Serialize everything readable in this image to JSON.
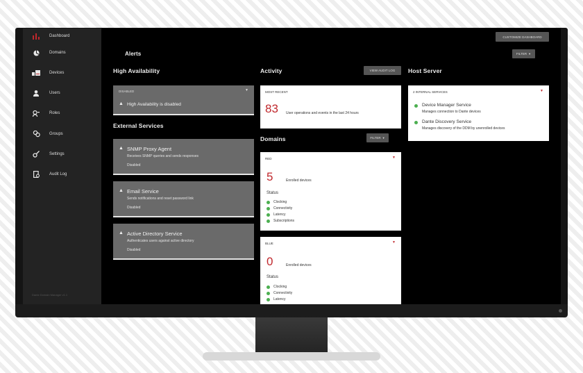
{
  "sidebar": {
    "items": [
      {
        "label": "Dashboard",
        "icon": "bar-chart-icon"
      },
      {
        "label": "Domains",
        "icon": "domains-icon"
      },
      {
        "label": "Devices",
        "icon": "devices-icon"
      },
      {
        "label": "Users",
        "icon": "user-icon"
      },
      {
        "label": "Roles",
        "icon": "roles-icon"
      },
      {
        "label": "Groups",
        "icon": "groups-icon"
      },
      {
        "label": "Settings",
        "icon": "settings-icon"
      },
      {
        "label": "Audit Log",
        "icon": "audit-log-icon"
      }
    ],
    "version": "Dante Domain Manager v1.1"
  },
  "header": {
    "customize_label": "CUSTOMIZE DASHBOARD",
    "alerts_title": "Alerts",
    "filter_label": "FILTER"
  },
  "high_availability": {
    "title": "High Availability",
    "state": "DISABLED",
    "message": "High Availability is disabled"
  },
  "external_services": {
    "title": "External Services",
    "items": [
      {
        "name": "SNMP Proxy Agent",
        "desc": "Receives SNMP queries and sends responses",
        "status": "Disabled"
      },
      {
        "name": "Email Service",
        "desc": "Sends notifications and reset password link",
        "status": "Disabled"
      },
      {
        "name": "Active Directory Service",
        "desc": "Authenticates users against active directory",
        "status": "Disabled"
      }
    ]
  },
  "activity": {
    "title": "Activity",
    "button_label": "VIEW AUDIT LOG",
    "card_label": "MOST RECENT",
    "count": "83",
    "count_text": "User operations and events in the last 24 hours"
  },
  "domains": {
    "title": "Domains",
    "filter_label": "FILTER",
    "cards": [
      {
        "name": "RED",
        "count": "5",
        "count_text": "Enrolled devices",
        "status_title": "Status",
        "statuses": [
          "Clocking",
          "Connectivity",
          "Latency",
          "Subscriptions"
        ]
      },
      {
        "name": "BLUE",
        "count": "0",
        "count_text": "Enrolled devices",
        "status_title": "Status",
        "statuses": [
          "Clocking",
          "Connectivity",
          "Latency"
        ]
      }
    ]
  },
  "host_server": {
    "title": "Host Server",
    "card_label": "2 INTERNAL SERVICES",
    "services": [
      {
        "name": "Device Manager Service",
        "desc": "Manages connection to Dante devices"
      },
      {
        "name": "Dante Discovery Service",
        "desc": "Manages discovery of the DDM by unenrolled devices"
      }
    ]
  },
  "colors": {
    "accent": "#c0282d",
    "ok": "#4caf50",
    "card_grey": "#6a6a6a"
  }
}
